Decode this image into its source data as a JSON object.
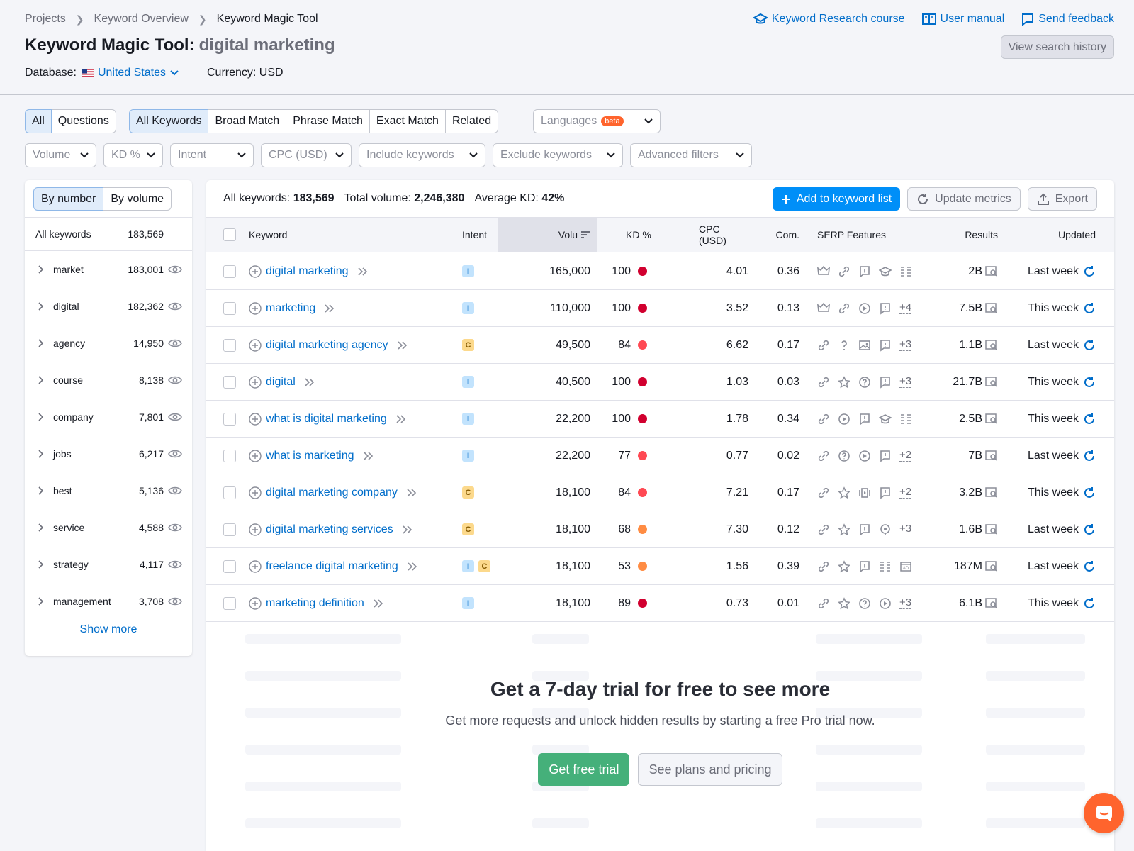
{
  "breadcrumb": [
    "Projects",
    "Keyword Overview",
    "Keyword Magic Tool"
  ],
  "title": {
    "tool": "Keyword Magic Tool:",
    "query": "digital marketing"
  },
  "database": {
    "label": "Database:",
    "country": "United States",
    "currency": "Currency: USD"
  },
  "top_links": {
    "course": "Keyword Research course",
    "manual": "User manual",
    "feedback": "Send feedback",
    "history": "View search history"
  },
  "tabs_type": [
    "All",
    "Questions"
  ],
  "tabs_match": [
    "All Keywords",
    "Broad Match",
    "Phrase Match",
    "Exact Match",
    "Related"
  ],
  "languages": {
    "label": "Languages",
    "badge": "beta"
  },
  "filters": [
    "Volume",
    "KD %",
    "Intent",
    "CPC (USD)",
    "Include keywords",
    "Exclude keywords",
    "Advanced filters"
  ],
  "sidebar": {
    "toggle": [
      "By number",
      "By volume"
    ],
    "all_label": "All keywords",
    "all_count": "183,569",
    "items": [
      {
        "label": "market",
        "count": "183,001"
      },
      {
        "label": "digital",
        "count": "182,362"
      },
      {
        "label": "agency",
        "count": "14,950"
      },
      {
        "label": "course",
        "count": "8,138"
      },
      {
        "label": "company",
        "count": "7,801"
      },
      {
        "label": "jobs",
        "count": "6,217"
      },
      {
        "label": "best",
        "count": "5,136"
      },
      {
        "label": "service",
        "count": "4,588"
      },
      {
        "label": "strategy",
        "count": "4,117"
      },
      {
        "label": "management",
        "count": "3,708"
      }
    ],
    "show_more": "Show more"
  },
  "summary": {
    "all_label": "All keywords:",
    "all_value": "183,569",
    "volume_label": "Total volume:",
    "volume_value": "2,246,380",
    "kd_label": "Average KD:",
    "kd_value": "42%"
  },
  "actions": {
    "add": "Add to keyword list",
    "update": "Update metrics",
    "export": "Export"
  },
  "columns": {
    "keyword": "Keyword",
    "intent": "Intent",
    "volume": "Volu",
    "kd": "KD %",
    "cpc": "CPC (USD)",
    "com": "Com.",
    "serp": "SERP Features",
    "results": "Results",
    "updated": "Updated"
  },
  "colors": {
    "kd_red": "#d1002f",
    "kd_lightred": "#ff4953",
    "kd_orange": "#ff8c43"
  },
  "rows": [
    {
      "keyword": "digital marketing",
      "intent": [
        "I"
      ],
      "volume": "165,000",
      "kd": "100",
      "kd_color": "#d1002f",
      "cpc": "4.01",
      "com": "0.36",
      "serp": [
        "crown-icon",
        "link-icon",
        "review-icon",
        "graduation-icon",
        "list-icon"
      ],
      "more": "",
      "results": "2B",
      "updated": "Last week"
    },
    {
      "keyword": "marketing",
      "intent": [
        "I"
      ],
      "volume": "110,000",
      "kd": "100",
      "kd_color": "#d1002f",
      "cpc": "3.52",
      "com": "0.13",
      "serp": [
        "crown-icon",
        "link-icon",
        "video-icon",
        "review-icon"
      ],
      "more": "+4",
      "results": "7.5B",
      "updated": "This week"
    },
    {
      "keyword": "digital marketing agency",
      "intent": [
        "C"
      ],
      "volume": "49,500",
      "kd": "84",
      "kd_color": "#ff4953",
      "cpc": "6.62",
      "com": "0.17",
      "serp": [
        "link-icon",
        "question-icon",
        "image-icon",
        "review-icon"
      ],
      "more": "+3",
      "results": "1.1B",
      "updated": "Last week"
    },
    {
      "keyword": "digital",
      "intent": [
        "I"
      ],
      "volume": "40,500",
      "kd": "100",
      "kd_color": "#d1002f",
      "cpc": "1.03",
      "com": "0.03",
      "serp": [
        "link-icon",
        "star-icon",
        "faq-icon",
        "review-icon"
      ],
      "more": "+3",
      "results": "21.7B",
      "updated": "This week"
    },
    {
      "keyword": "what is digital marketing",
      "intent": [
        "I"
      ],
      "volume": "22,200",
      "kd": "100",
      "kd_color": "#d1002f",
      "cpc": "1.78",
      "com": "0.34",
      "serp": [
        "link-icon",
        "video-icon",
        "review-icon",
        "graduation-icon",
        "list-icon"
      ],
      "more": "",
      "results": "2.5B",
      "updated": "This week"
    },
    {
      "keyword": "what is marketing",
      "intent": [
        "I"
      ],
      "volume": "22,200",
      "kd": "77",
      "kd_color": "#ff4953",
      "cpc": "0.77",
      "com": "0.02",
      "serp": [
        "link-icon",
        "faq-icon",
        "video-icon",
        "review-icon"
      ],
      "more": "+2",
      "results": "7B",
      "updated": "Last week"
    },
    {
      "keyword": "digital marketing company",
      "intent": [
        "C"
      ],
      "volume": "18,100",
      "kd": "84",
      "kd_color": "#ff4953",
      "cpc": "7.21",
      "com": "0.17",
      "serp": [
        "link-icon",
        "star-icon",
        "carousel-icon",
        "review-icon"
      ],
      "more": "+2",
      "results": "3.2B",
      "updated": "This week"
    },
    {
      "keyword": "digital marketing services",
      "intent": [
        "C"
      ],
      "volume": "18,100",
      "kd": "68",
      "kd_color": "#ff8c43",
      "cpc": "7.30",
      "com": "0.12",
      "serp": [
        "link-icon",
        "star-icon",
        "review-icon",
        "location-icon"
      ],
      "more": "+3",
      "results": "1.6B",
      "updated": "Last week"
    },
    {
      "keyword": "freelance digital marketing",
      "intent": [
        "I",
        "C"
      ],
      "volume": "18,100",
      "kd": "53",
      "kd_color": "#ff8c43",
      "cpc": "1.56",
      "com": "0.39",
      "serp": [
        "link-icon",
        "star-icon",
        "review-icon",
        "list-icon",
        "ad-icon"
      ],
      "more": "",
      "results": "187M",
      "updated": "Last week"
    },
    {
      "keyword": "marketing definition",
      "intent": [
        "I"
      ],
      "volume": "18,100",
      "kd": "89",
      "kd_color": "#d1002f",
      "cpc": "0.73",
      "com": "0.01",
      "serp": [
        "link-icon",
        "star-icon",
        "faq-icon",
        "video-icon"
      ],
      "more": "+3",
      "results": "6.1B",
      "updated": "This week"
    }
  ],
  "trial": {
    "title": "Get a 7-day trial for free to see more",
    "subtitle": "Get more requests and unlock hidden results by starting a free Pro trial now.",
    "cta": "Get free trial",
    "plans": "See plans and pricing"
  }
}
